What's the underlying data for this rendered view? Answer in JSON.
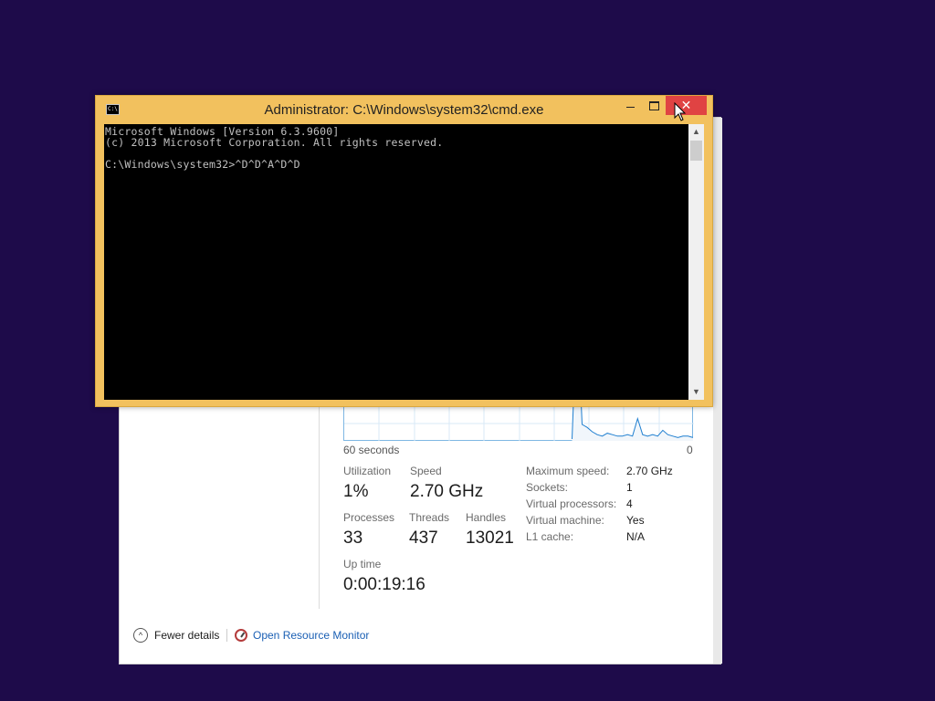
{
  "colors": {
    "desktop_background": "#1e0b4a",
    "cmd_frame": "#f2c15e",
    "close_button": "#e04343",
    "console_background": "#000000",
    "console_text": "#c0c0c0",
    "graph_line": "#1f7fd0",
    "link": "#1a5fb4"
  },
  "cmd": {
    "title": "Administrator: C:\\Windows\\system32\\cmd.exe",
    "icon_text": "C:\\",
    "controls": {
      "minimize_icon": "minimize-icon",
      "maximize_icon": "maximize-icon",
      "close_icon": "close-icon",
      "close_glyph": "✕"
    },
    "lines": [
      "Microsoft Windows [Version 6.3.9600]",
      "(c) 2013 Microsoft Corporation. All rights reserved.",
      "",
      "C:\\Windows\\system32>^D^D^A^D^D"
    ],
    "scroll_up_glyph": "▲",
    "scroll_down_glyph": "▼"
  },
  "task_manager": {
    "graph": {
      "time_label": "60 seconds",
      "min_label": "0",
      "utilization_series": [
        0,
        0,
        0,
        0,
        0,
        0,
        0,
        0,
        0,
        0,
        0,
        0,
        0,
        0,
        0,
        0,
        0,
        0,
        0,
        0,
        0,
        0,
        0,
        0,
        0,
        0,
        0,
        0,
        0,
        0,
        0,
        0,
        0,
        0,
        0,
        0,
        0,
        0,
        0,
        0,
        0,
        0,
        0,
        0,
        0,
        0,
        90,
        10,
        8,
        5,
        3,
        2,
        4,
        3,
        2,
        2,
        3,
        2,
        14,
        3,
        2,
        3,
        2,
        6,
        3,
        2,
        1,
        2,
        2,
        1
      ]
    },
    "stats": {
      "utilization": {
        "label": "Utilization",
        "value": "1%"
      },
      "speed": {
        "label": "Speed",
        "value": "2.70 GHz"
      },
      "processes": {
        "label": "Processes",
        "value": "33"
      },
      "threads": {
        "label": "Threads",
        "value": "437"
      },
      "handles": {
        "label": "Handles",
        "value": "13021"
      },
      "uptime": {
        "label": "Up time",
        "value": "0:00:19:16"
      }
    },
    "specs": [
      {
        "label": "Maximum speed:",
        "value": "2.70 GHz"
      },
      {
        "label": "Sockets:",
        "value": "1"
      },
      {
        "label": "Virtual processors:",
        "value": "4"
      },
      {
        "label": "Virtual machine:",
        "value": "Yes"
      },
      {
        "label": "L1 cache:",
        "value": "N/A"
      }
    ],
    "footer": {
      "fewer_details": "Fewer details",
      "chevron_glyph": "^",
      "open_resource_monitor": "Open Resource Monitor"
    }
  }
}
